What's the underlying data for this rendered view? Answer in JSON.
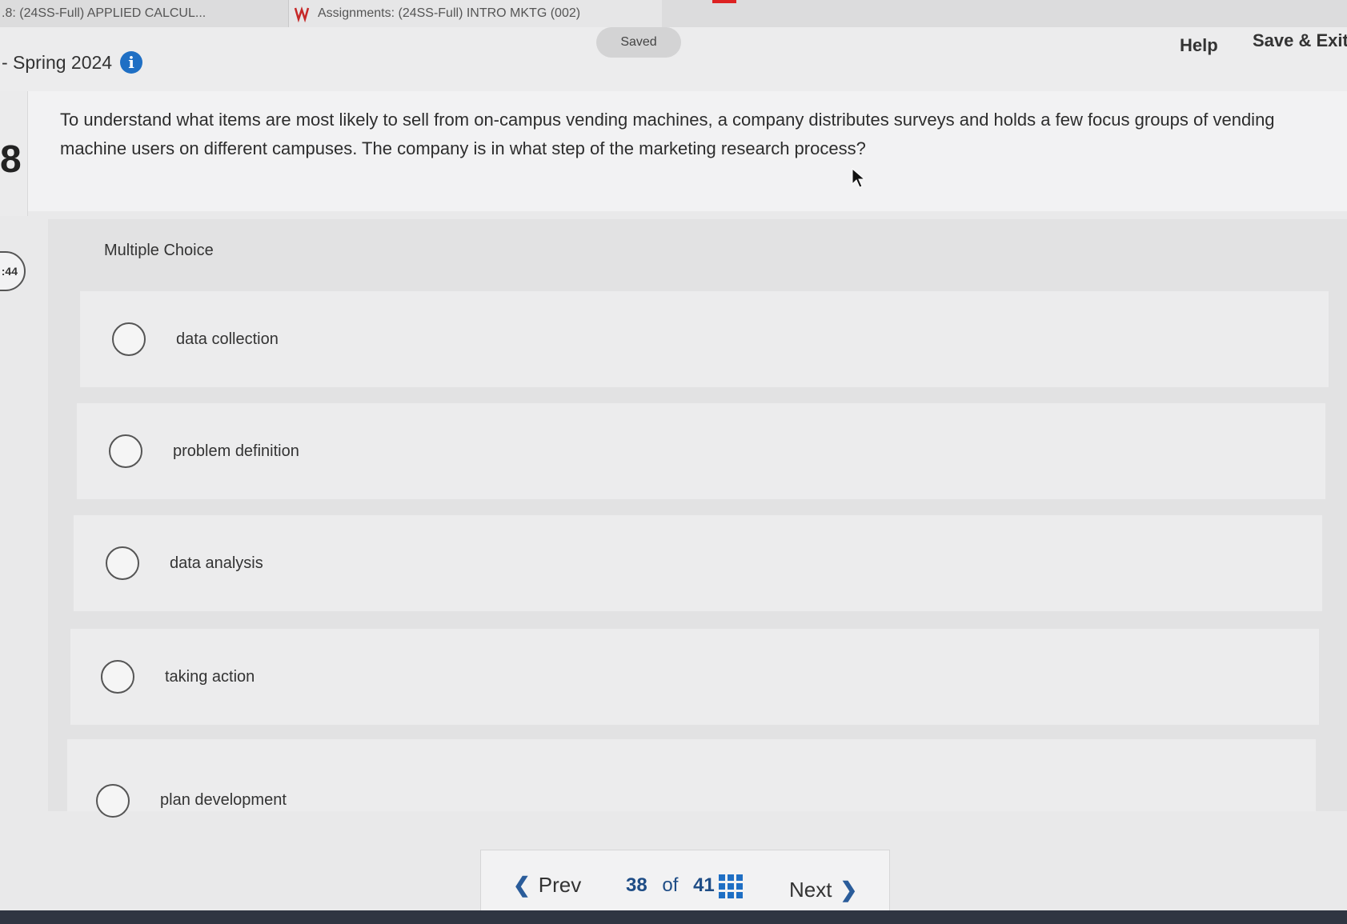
{
  "browser_tabs": {
    "tab1_label": ".8: (24SS-Full) APPLIED CALCUL...",
    "tab2_label": "Assignments: (24SS-Full) INTRO MKTG (002)"
  },
  "header": {
    "course_label": "- Spring 2024",
    "saved_status": "Saved",
    "help_label": "Help",
    "save_exit_label": "Save & Exit"
  },
  "question": {
    "number_fragment": "8",
    "text": "To understand what items are most likely to sell from on-campus vending machines, a company distributes surveys and holds a few focus groups of vending machine users on different campuses. The company is in what step of the marketing research process?",
    "timer_fragment": ":44"
  },
  "answer": {
    "type_label": "Multiple Choice",
    "choices": [
      {
        "label": "data collection"
      },
      {
        "label": "problem definition"
      },
      {
        "label": "data analysis"
      },
      {
        "label": "taking action"
      },
      {
        "label": "plan development"
      }
    ]
  },
  "pager": {
    "prev_label": "Prev",
    "current": "38",
    "of_label": "of",
    "total": "41",
    "next_label": "Next"
  },
  "colors": {
    "accent": "#1f6fc4",
    "background": "#e9e9ea"
  }
}
